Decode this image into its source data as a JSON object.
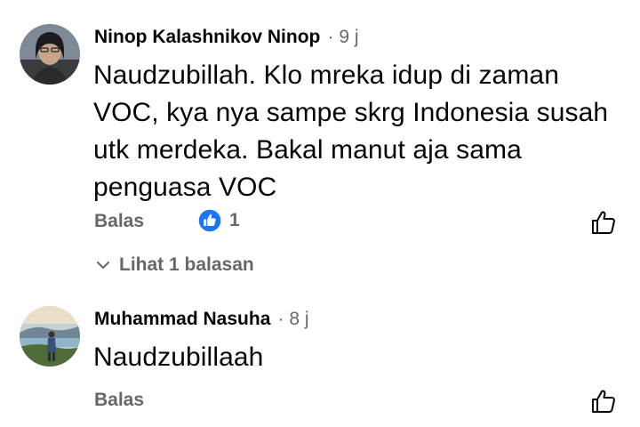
{
  "comments": [
    {
      "author": "Ninop Kalashnikov Ninop",
      "time": "9 j",
      "body_lines": [
        "Naudzubillah. Klo mreka idup di zaman",
        "VOC, kya nya sampe skrg Indonesia susah",
        "utk merdeka. Bakal manut aja sama",
        "penguasa VOC"
      ],
      "reply_label": "Balas",
      "like_count": "1",
      "view_replies_label": "Lihat 1 balasan"
    },
    {
      "author": "Muhammad Nasuha",
      "time": "8 j",
      "body_lines": [
        "Naudzubillaah"
      ],
      "reply_label": "Balas"
    }
  ],
  "colors": {
    "text_primary": "#050505",
    "text_secondary": "#65676b",
    "like_blue": "#1877f2"
  },
  "icons": {
    "separator": "·",
    "like_reaction": "like-reaction-icon",
    "thumb_up": "thumb-up-outline-icon",
    "chevron": "chevron-down-icon"
  }
}
